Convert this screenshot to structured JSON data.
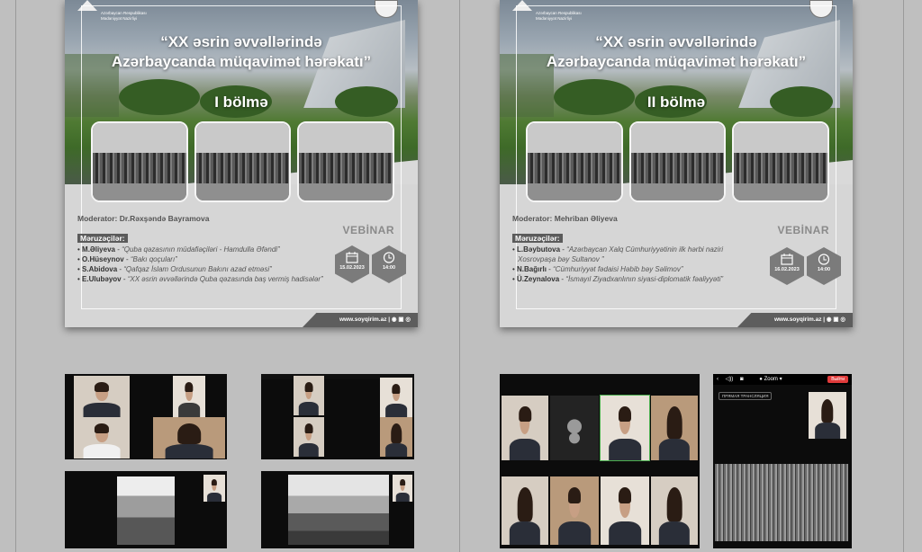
{
  "poster_left": {
    "logo_text": "Azərbaycan Respublikası\nMədəniyyət Nazirliyi",
    "title_line1": "“XX əsrin əvvəllərində",
    "title_line2": "Azərbaycanda müqavimət hərəkatı”",
    "section": "I bölmə",
    "moderator": "Moderator: Dr.Rəxşəndə Bayramova",
    "format": "VEBİNAR",
    "speakers_heading": "Məruzəçilər:",
    "speakers": [
      {
        "name": "M.Əliyeva",
        "topic": "“Quba qəzasının müdafiəçiləri - Hamdulla Əfəndi”"
      },
      {
        "name": "O.Hüseynov",
        "topic": "“Bakı qoçuları”"
      },
      {
        "name": "S.Abidova",
        "topic": "“Qafqaz İslam Ordusunun Bakını azad etməsi”"
      },
      {
        "name": "E.Ulubəyov",
        "topic": "“XX əsrin əvvəllərində Quba qəzasında baş vermiş hadisələr”"
      }
    ],
    "date": "15.02.2023",
    "time": "14:00",
    "website": "www.soyqirim.az"
  },
  "poster_right": {
    "logo_text": "Azərbaycan Respublikası\nMədəniyyət Nazirliyi",
    "title_line1": "“XX əsrin əvvəllərində",
    "title_line2": "Azərbaycanda müqavimət hərəkatı”",
    "section": "II bölmə",
    "moderator": "Moderator: Mehriban Əliyeva",
    "format": "VEBİNAR",
    "speakers_heading": "Məruzəçilər:",
    "speakers": [
      {
        "name": "L.Bəybutova",
        "topic": "“Azərbaycan Xalq Cümhuriyyətinin ilk hərbi naziri Xosrovpaşa bəy Sultanov ”"
      },
      {
        "name": "N.Bağırlı",
        "topic": "“Cümhuriyyət fədaisi Həbib bəy Səlimov”"
      },
      {
        "name": "Ü.Zeynalova",
        "topic": "“İsmayıl Ziyadxanlının siyasi-diplomatik fəaliyyəti”"
      }
    ],
    "date": "16.02.2023",
    "time": "14:00",
    "website": "www.soyqirim.az"
  },
  "zoom": {
    "menu_label": "Zoom",
    "exit_label": "Выйти",
    "live_label": "ПРЯМАЯ ТРАНСЛЯЦИЯ"
  }
}
